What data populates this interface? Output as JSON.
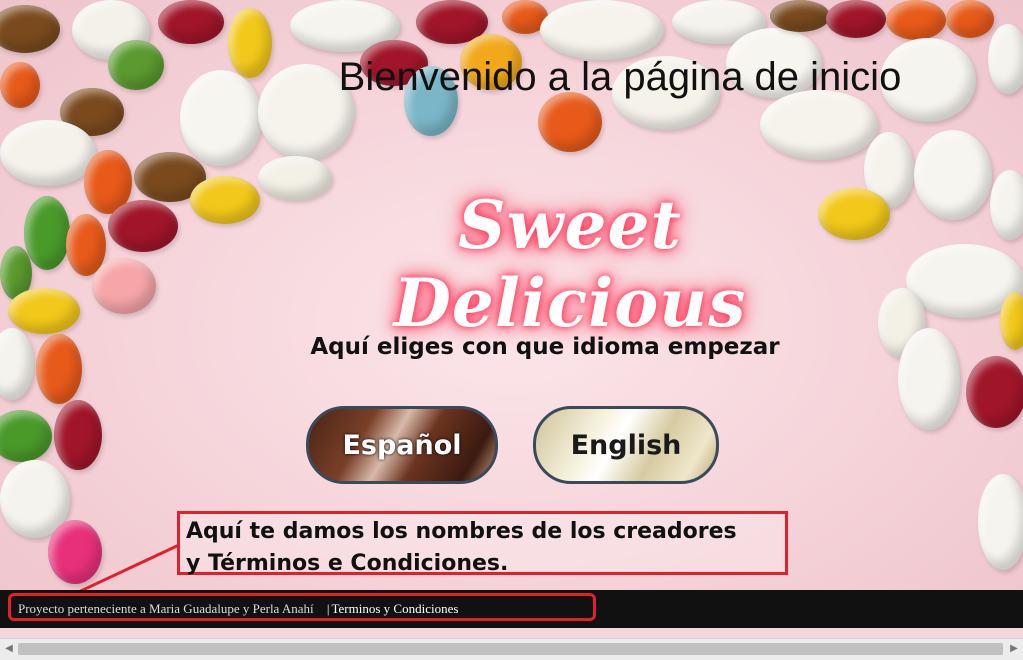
{
  "page": {
    "title": "Bienvenido a la página de inicio",
    "logo": "Sweet Delicious",
    "prompt": "Aquí eliges con que idioma empezar"
  },
  "language_buttons": {
    "spanish": "Español",
    "english": "English"
  },
  "annotation": {
    "line1": "Aquí te damos los nombres de los creadores",
    "line2": "y Términos  e Condiciones."
  },
  "footer": {
    "credits": "Proyecto perteneciente a Maria Guadalupe y Perla Anahí",
    "separator": "|",
    "terms_link": "Terminos y Condiciones"
  },
  "colors": {
    "annotation_red": "#e0202a",
    "footer_bg": "#111111",
    "logo_glow": "#ff3a5a"
  }
}
